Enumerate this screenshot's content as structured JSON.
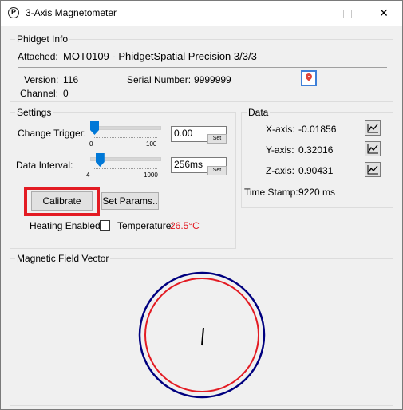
{
  "window": {
    "title": "3-Axis Magnetometer",
    "app_icon": "phidget-logo-icon"
  },
  "phidget_info": {
    "group_title": "Phidget Info",
    "attached_label": "Attached:",
    "attached_value": "MOT0109 - PhidgetSpatial Precision 3/3/3",
    "version_label": "Version:",
    "version_value": "116",
    "serial_label": "Serial Number:",
    "serial_value": "9999999",
    "channel_label": "Channel:",
    "channel_value": "0",
    "location_icon": "map-pin-icon"
  },
  "settings": {
    "group_title": "Settings",
    "change_trigger": {
      "label": "Change Trigger:",
      "min": "0",
      "max": "100",
      "value": "0.00",
      "slider_fraction": 0.0,
      "set_label": "Set"
    },
    "data_interval": {
      "label": "Data Interval:",
      "min": "4",
      "max": "1000",
      "value": "256ms",
      "slider_fraction": 0.06,
      "set_label": "Set"
    },
    "calibrate_label": "Calibrate",
    "set_params_label": "Set Params..",
    "heating_label": "Heating Enabled:",
    "heating_checked": false,
    "temperature_label": "Temperature:",
    "temperature_value": "26.5°C"
  },
  "data": {
    "group_title": "Data",
    "x_label": "X-axis:",
    "x_value": "-0.01856",
    "y_label": "Y-axis:",
    "y_value": "0.32016",
    "z_label": "Z-axis:",
    "z_value": "0.90431",
    "timestamp_label": "Time Stamp:",
    "timestamp_value": "9220 ms",
    "graph_icon": "line-graph-icon"
  },
  "field_vector": {
    "group_title": "Magnetic Field Vector",
    "colors": {
      "outer": "#00007f",
      "inner": "#e31b23",
      "vector": "#000000"
    }
  }
}
